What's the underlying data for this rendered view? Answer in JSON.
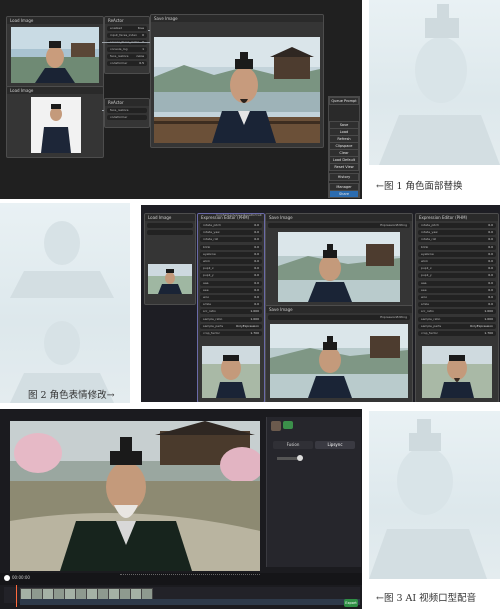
{
  "panel1": {
    "nodes": {
      "load_image_title": "Load Image",
      "face_swap_title": "ReActor",
      "preview_title": "Save Image",
      "small_rows": [
        "enabled",
        "input_faces_index",
        "source_faces_index",
        "console_log",
        "face_restore",
        "codeformer"
      ],
      "small_values": [
        "true",
        "0",
        "0",
        "1",
        "none",
        "0.5"
      ]
    },
    "queue_menu": {
      "title": "Queue Prompt",
      "items": [
        "Save",
        "Load",
        "Refresh",
        "Clipspace",
        "Clear",
        "Load Default",
        "Reset View"
      ],
      "history_label": "History",
      "manager_label": "Manager",
      "share_label": "Share"
    },
    "caption": "←图 1  角色面部替换"
  },
  "panel2": {
    "load_image_title": "Load Image",
    "expr_title": "Expression Editor (PHM)",
    "expr_badge": "ComfyUI-AdvancedLivePortrait",
    "save_title": "Save Image",
    "expr_rows": [
      "rotate_pitch",
      "rotate_yaw",
      "rotate_roll",
      "blink",
      "eyebrow",
      "wink",
      "pupil_x",
      "pupil_y",
      "aaa",
      "eee",
      "woo",
      "smile",
      "src_ratio",
      "sample_ratio",
      "sample_parts",
      "crop_factor"
    ],
    "expr_values": [
      "0.0",
      "0.0",
      "0.0",
      "0.0",
      "0.0",
      "0.0",
      "0.0",
      "0.0",
      "0.0",
      "0.0",
      "0.0",
      "0.0",
      "1.000",
      "1.000",
      "OnlyExpression",
      "1.700"
    ],
    "image_label": "ExpressionEditing",
    "caption": "图 2  角色表情修改→"
  },
  "panel3": {
    "tab_left": "Fusion",
    "tab_right": "Lipsync",
    "timecode": "00:00:00",
    "export_label": "Export",
    "caption": "←图 3  AI 视频口型配音"
  }
}
